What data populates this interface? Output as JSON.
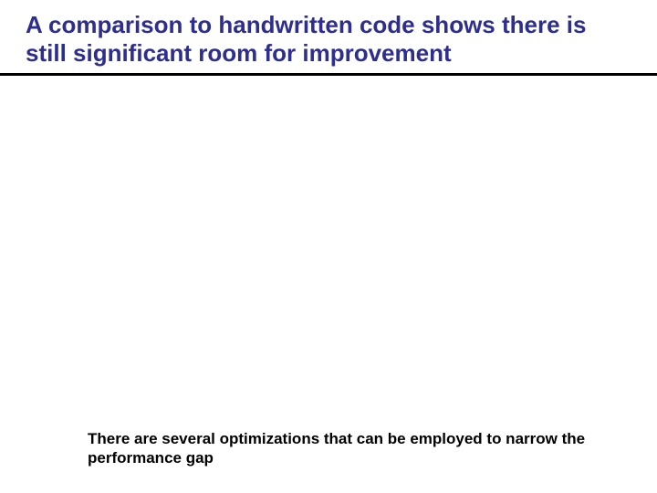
{
  "slide": {
    "title": "A comparison to handwritten code shows there is still significant room for improvement",
    "body": "There are several optimizations that can be employed to narrow the performance gap"
  }
}
